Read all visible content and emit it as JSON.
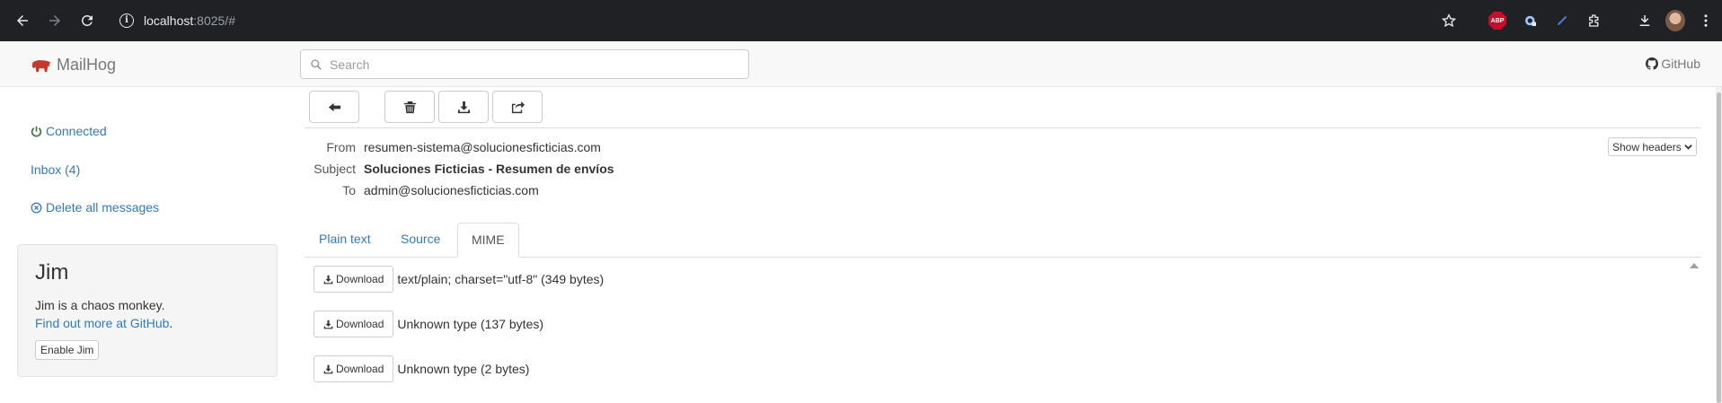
{
  "browser": {
    "url_host": "localhost",
    "url_rest": ":8025/#",
    "extensions": [
      "abp-extension-icon",
      "password-manager-icon",
      "pen-extension-icon",
      "puzzle-extensions-icon"
    ],
    "abp_text": "ABP"
  },
  "navbar": {
    "brand": "MailHog",
    "search_placeholder": "Search",
    "github_label": "GitHub"
  },
  "sidebar": {
    "connected": "Connected",
    "inbox": "Inbox (4)",
    "delete_all": "Delete all messages",
    "jim": {
      "title": "Jim",
      "description": "Jim is a chaos monkey.",
      "link_text": "Find out more at GitHub",
      "link_suffix": ".",
      "button": "Enable Jim"
    }
  },
  "message": {
    "headers": [
      {
        "label": "From",
        "value": "resumen-sistema@solucionesficticias.com"
      },
      {
        "label": "Subject",
        "value": "Soluciones Ficticias - Resumen de envíos"
      },
      {
        "label": "To",
        "value": "admin@solucionesficticias.com"
      }
    ],
    "show_headers": "Show headers",
    "tabs": [
      {
        "label": "Plain text",
        "active": false
      },
      {
        "label": "Source",
        "active": false
      },
      {
        "label": "MIME",
        "active": true
      }
    ],
    "mime_parts": [
      {
        "button": "Download",
        "description": "text/plain; charset=\"utf-8\" (349 bytes)"
      },
      {
        "button": "Download",
        "description": "Unknown type (137 bytes)"
      },
      {
        "button": "Download",
        "description": "Unknown type (2 bytes)"
      }
    ]
  }
}
